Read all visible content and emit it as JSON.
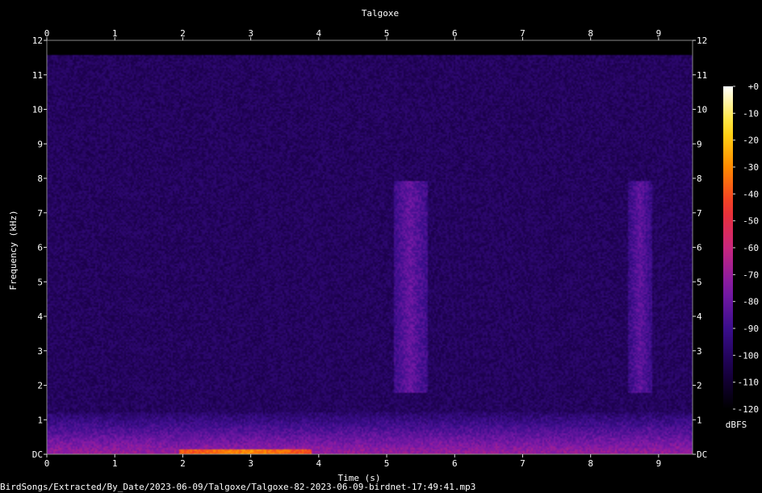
{
  "chart_data": {
    "type": "heatmap",
    "title": "Talgoxe",
    "xlabel": "Time (s)",
    "ylabel": "Frequency (kHz)",
    "xlim": [
      0,
      9.5
    ],
    "ylim": [
      0,
      12
    ],
    "x_ticks": [
      "0",
      "1",
      "2",
      "3",
      "4",
      "5",
      "6",
      "7",
      "8",
      "9"
    ],
    "y_ticks": [
      "DC",
      "1",
      "2",
      "3",
      "4",
      "5",
      "6",
      "7",
      "8",
      "9",
      "10",
      "11",
      "12"
    ],
    "colorbar": {
      "label": "dBFS",
      "range": [
        -120,
        0
      ],
      "ticks": [
        "+0",
        "-10",
        "-20",
        "-30",
        "-40",
        "-50",
        "-60",
        "-70",
        "-80",
        "-90",
        "-100",
        "-110",
        "-120"
      ]
    },
    "colormap": [
      "#000000",
      "#1a0048",
      "#3a0e8c",
      "#7d1aa8",
      "#c8267d",
      "#f0322c",
      "#ff8a00",
      "#ffe11a",
      "#ffffff"
    ],
    "background_level_dbfs": -100,
    "low_frequency_noise_band_khz": [
      0,
      1.2
    ],
    "events": [
      {
        "t_start": 5.1,
        "t_end": 5.6,
        "f_low": 1.8,
        "f_high": 7.9,
        "level_dbfs": -80
      },
      {
        "t_start": 8.55,
        "t_end": 8.9,
        "f_low": 1.8,
        "f_high": 7.9,
        "level_dbfs": -82
      },
      {
        "t_start": 1.95,
        "t_end": 3.9,
        "f_low": 0,
        "f_high": 0.15,
        "level_dbfs": -30
      }
    ]
  },
  "footer": {
    "file_path": "BirdSongs/Extracted/By_Date/2023-06-09/Talgoxe/Talgoxe-82-2023-06-09-birdnet-17:49:41.mp3"
  }
}
